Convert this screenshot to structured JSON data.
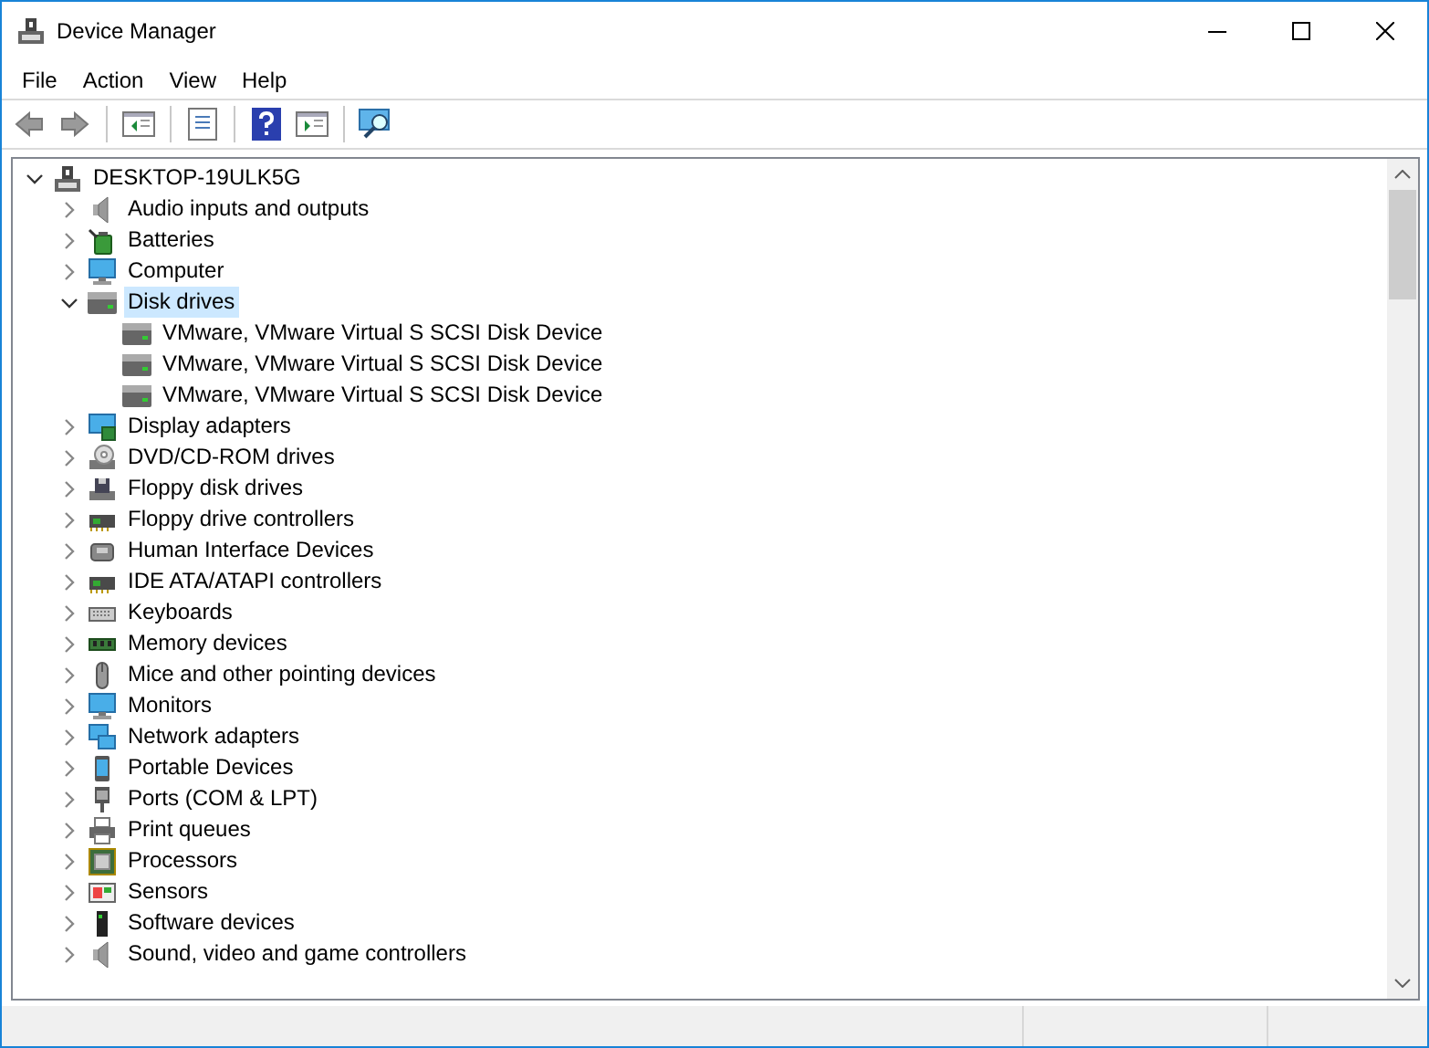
{
  "window": {
    "title": "Device Manager"
  },
  "menu": [
    "File",
    "Action",
    "View",
    "Help"
  ],
  "tree": [
    {
      "label": "DESKTOP-19ULK5G",
      "kind": "computer-root",
      "expanded": true,
      "selected": false,
      "children": [
        {
          "label": "Audio inputs and outputs",
          "kind": "speaker",
          "expanded": false,
          "selected": false
        },
        {
          "label": "Batteries",
          "kind": "battery",
          "expanded": false,
          "selected": false
        },
        {
          "label": "Computer",
          "kind": "monitor",
          "expanded": false,
          "selected": false
        },
        {
          "label": "Disk drives",
          "kind": "disk",
          "expanded": true,
          "selected": true,
          "children": [
            {
              "label": "VMware, VMware Virtual S SCSI Disk Device",
              "kind": "disk",
              "selected": false
            },
            {
              "label": "VMware, VMware Virtual S SCSI Disk Device",
              "kind": "disk",
              "selected": false
            },
            {
              "label": "VMware, VMware Virtual S SCSI Disk Device",
              "kind": "disk",
              "selected": false
            }
          ]
        },
        {
          "label": "Display adapters",
          "kind": "display",
          "expanded": false,
          "selected": false
        },
        {
          "label": "DVD/CD-ROM drives",
          "kind": "disc",
          "expanded": false,
          "selected": false
        },
        {
          "label": "Floppy disk drives",
          "kind": "floppy",
          "expanded": false,
          "selected": false
        },
        {
          "label": "Floppy drive controllers",
          "kind": "controller",
          "expanded": false,
          "selected": false
        },
        {
          "label": "Human Interface Devices",
          "kind": "hid",
          "expanded": false,
          "selected": false
        },
        {
          "label": "IDE ATA/ATAPI controllers",
          "kind": "controller",
          "expanded": false,
          "selected": false
        },
        {
          "label": "Keyboards",
          "kind": "keyboard",
          "expanded": false,
          "selected": false
        },
        {
          "label": "Memory devices",
          "kind": "memory",
          "expanded": false,
          "selected": false
        },
        {
          "label": "Mice and other pointing devices",
          "kind": "mouse",
          "expanded": false,
          "selected": false
        },
        {
          "label": "Monitors",
          "kind": "monitor",
          "expanded": false,
          "selected": false
        },
        {
          "label": "Network adapters",
          "kind": "network",
          "expanded": false,
          "selected": false
        },
        {
          "label": "Portable Devices",
          "kind": "portable",
          "expanded": false,
          "selected": false
        },
        {
          "label": "Ports (COM & LPT)",
          "kind": "port",
          "expanded": false,
          "selected": false
        },
        {
          "label": "Print queues",
          "kind": "printer",
          "expanded": false,
          "selected": false
        },
        {
          "label": "Processors",
          "kind": "processor",
          "expanded": false,
          "selected": false
        },
        {
          "label": "Sensors",
          "kind": "sensor",
          "expanded": false,
          "selected": false
        },
        {
          "label": "Software devices",
          "kind": "software",
          "expanded": false,
          "selected": false
        },
        {
          "label": "Sound, video and game controllers",
          "kind": "speaker",
          "expanded": false,
          "selected": false
        }
      ]
    }
  ]
}
